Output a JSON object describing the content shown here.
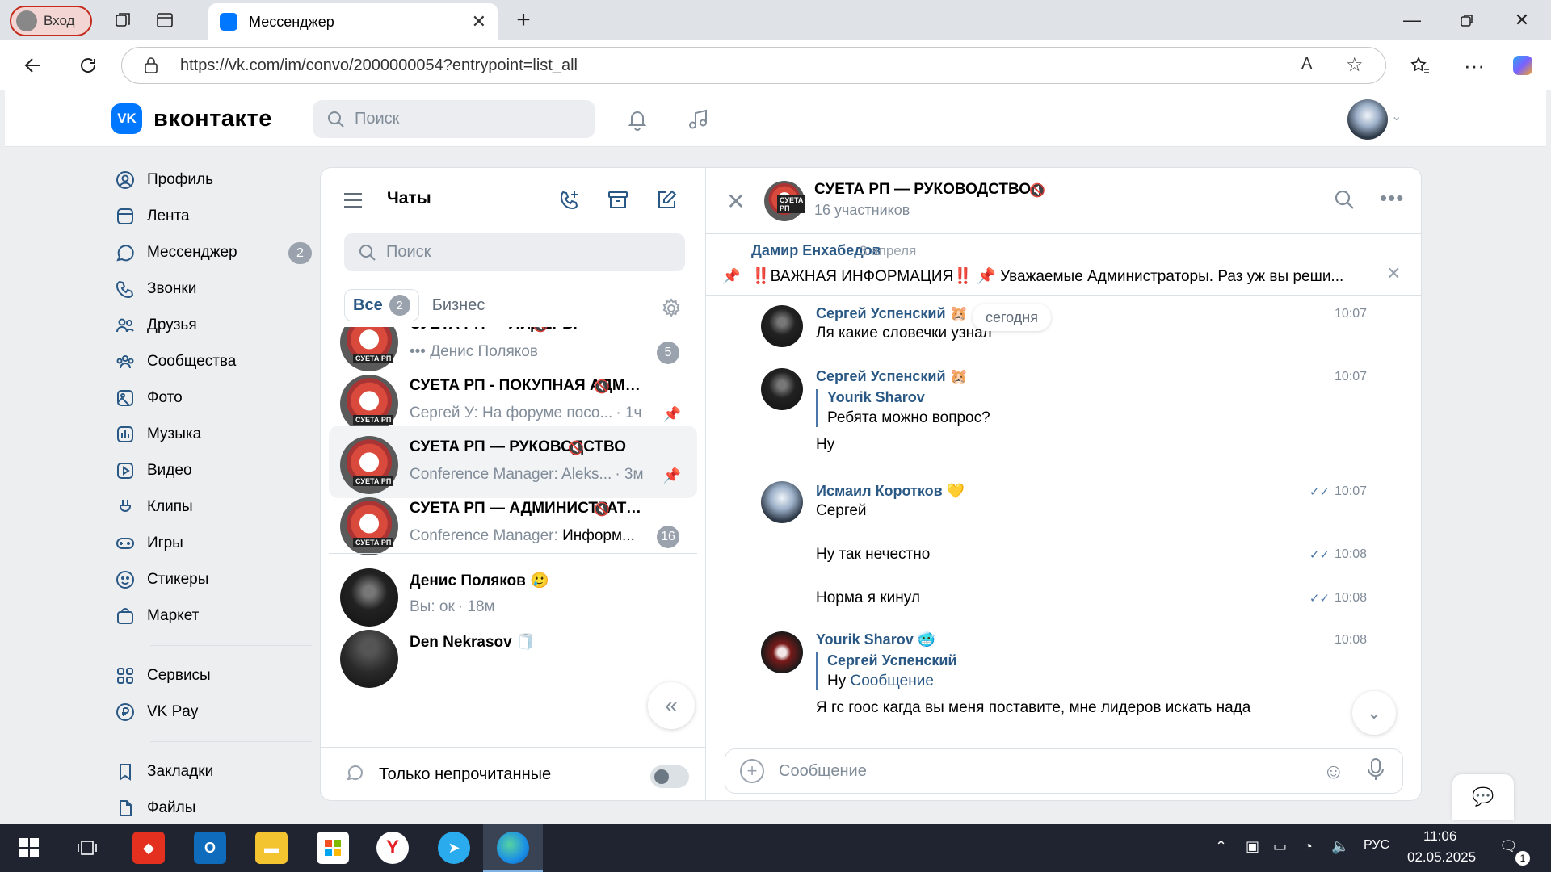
{
  "browser": {
    "profile_label": "Вход",
    "tab_title": "Мессенджер",
    "url": "https://vk.com/im/convo/2000000054?entrypoint=list_all"
  },
  "vk": {
    "logo_text": "вконтакте",
    "logo_mark": "VK",
    "search_placeholder": "Поиск"
  },
  "menu": {
    "items": [
      {
        "label": "Профиль",
        "icon": "profile-icon"
      },
      {
        "label": "Лента",
        "icon": "feed-icon"
      },
      {
        "label": "Мессенджер",
        "icon": "messenger-icon",
        "badge": "2"
      },
      {
        "label": "Звонки",
        "icon": "phone-icon"
      },
      {
        "label": "Друзья",
        "icon": "friends-icon"
      },
      {
        "label": "Сообщества",
        "icon": "communities-icon"
      },
      {
        "label": "Фото",
        "icon": "photo-icon"
      },
      {
        "label": "Музыка",
        "icon": "music-icon"
      },
      {
        "label": "Видео",
        "icon": "video-icon"
      },
      {
        "label": "Клипы",
        "icon": "clips-icon"
      },
      {
        "label": "Игры",
        "icon": "games-icon"
      },
      {
        "label": "Стикеры",
        "icon": "stickers-icon"
      },
      {
        "label": "Маркет",
        "icon": "market-icon"
      }
    ],
    "items2": [
      {
        "label": "Сервисы",
        "icon": "services-icon"
      },
      {
        "label": "VK Pay",
        "icon": "vkpay-icon"
      }
    ],
    "items3": [
      {
        "label": "Закладки",
        "icon": "bookmark-icon"
      },
      {
        "label": "Файлы",
        "icon": "files-icon"
      }
    ]
  },
  "chat_list": {
    "title": "Чаты",
    "search_placeholder": "Поиск",
    "tab_all": "Все",
    "tab_all_badge": "2",
    "tab_business": "Бизнес",
    "chats": [
      {
        "name": "СУЕТА РП — ЛИДЕРЫ",
        "sender": "",
        "preview": "Денис Поляков",
        "time": "",
        "badge": "5",
        "pinned": false,
        "muted": true
      },
      {
        "name": "СУЕТА РП - ПОКУПНАЯ АДМИ...",
        "sender": "Сергей У: ",
        "preview": "На форуме посо...",
        "time": "· 1ч",
        "badge": "",
        "pinned": true,
        "muted": true
      },
      {
        "name": "СУЕТА РП — РУКОВОДСТВО",
        "sender": "Conference Manager: ",
        "preview": "Aleks...",
        "time": "· 3м",
        "badge": "",
        "pinned": true,
        "muted": true
      },
      {
        "name": "СУЕТА РП — АДМИНИСТРАТО...",
        "sender": "Conference Manager: ",
        "preview": "Информ...",
        "time": "",
        "badge": "16",
        "pinned": false,
        "muted": true
      },
      {
        "name": "Денис Поляков 🥲",
        "sender": "Вы: ",
        "preview": "ок",
        "time": "· 18м",
        "badge": "",
        "pinned": false,
        "muted": false
      },
      {
        "name": "Den Nekrasov 🧻",
        "sender": "",
        "preview": "",
        "time": "",
        "badge": "",
        "pinned": false,
        "muted": false
      }
    ],
    "unread_only_label": "Только непрочитанные",
    "unread_only_enabled": false
  },
  "conversation": {
    "title": "СУЕТА РП — РУКОВОДСТВО",
    "subtitle": "16 участников",
    "pinned": {
      "author": "Дамир Енхабедов",
      "date": "3 апреля",
      "text": "‼️ВАЖНАЯ ИНФОРМАЦИЯ‼️ 📌 Уважаемые Администраторы. Раз уж вы реши..."
    },
    "date_label": "сегодня",
    "messages": [
      {
        "author": "Сергей Успенский 🐹",
        "text": "Ля какие словечки узнал",
        "time": "10:07",
        "read": false
      },
      {
        "author": "Сергей Успенский 🐹",
        "reply_author": "Yourik Sharov",
        "reply_text": "Ребята можно вопрос?",
        "text": "Ну",
        "time": "10:07",
        "read": false
      },
      {
        "author": "Исмаил Коротков 💛",
        "text": "Сергей",
        "time": "10:07",
        "read": true
      },
      {
        "author": "",
        "text": "Ну так нечестно",
        "time": "10:08",
        "read": true
      },
      {
        "author": "",
        "text": "Норма я кинул",
        "time": "10:08",
        "read": true
      },
      {
        "author": "Yourik Sharov 🥶",
        "reply_author": "Сергей Успенский",
        "reply_text": "Ну",
        "reply_link": "Сообщение",
        "text": "Я гс гоос кагда вы меня поставите, мне лидеров искать нада",
        "time": "10:08",
        "read": false
      }
    ],
    "composer_placeholder": "Сообщение"
  },
  "taskbar": {
    "language": "РУС",
    "time": "11:06",
    "date": "02.05.2025",
    "notification_count": "1"
  }
}
